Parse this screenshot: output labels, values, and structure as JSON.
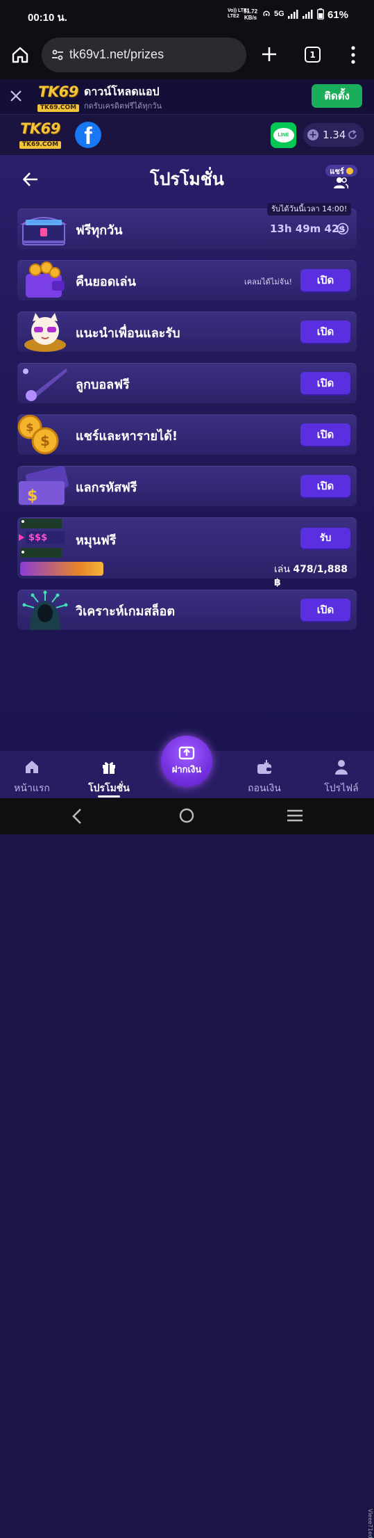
{
  "status_bar": {
    "time": "00:10 น.",
    "network_line1": "Vo)) LTE1",
    "network_line2": "LTE2",
    "speed_value": "51.72",
    "speed_unit": "KB/s",
    "network_type": "5G",
    "battery": "61%"
  },
  "browser": {
    "url": "tk69v1.net/prizes",
    "tab_count": "1"
  },
  "app_banner": {
    "logo_big": "TK69",
    "logo_small": "TK69.COM",
    "title": "ดาวน์โหลดแอป",
    "subtitle": "กดรับเครดิตฟรีได้ทุกวัน",
    "install_label": "ติดตั้ง"
  },
  "site_header": {
    "logo_big": "TK69",
    "logo_small": "TK69.COM",
    "facebook_glyph": "f",
    "line_label": "LINE",
    "balance": "1.34"
  },
  "page": {
    "title": "โปรโมชั่น",
    "share_label": "แชร์"
  },
  "promos": [
    {
      "label": "ฟรีทุกวัน",
      "tag": "รับได้วันนี้เวลา 14:00!",
      "timer": "13h 49m 42s"
    },
    {
      "label": "คืนยอดเล่น",
      "note": "เคลมได้ไม่จัน!",
      "button": "เปิด"
    },
    {
      "label": "แนะนำเพื่อนและรับ",
      "button": "เปิด"
    },
    {
      "label": "ลูกบอลฟรี",
      "button": "เปิด"
    },
    {
      "label": "แชร์และหารายได้!",
      "button": "เปิด"
    },
    {
      "label": "แลกรหัสฟรี",
      "button": "เปิด"
    },
    {
      "label": "หมุนฟรี",
      "button": "รับ",
      "play_label": "เล่น",
      "play_progress": "478/1,888 ฿",
      "progress_fraction": 0.253,
      "slot_text": "$$$"
    },
    {
      "label": "วิเคราะห์เกมสล็อต",
      "button": "เปิด"
    }
  ],
  "bottom_nav": {
    "home": "หน้าแรก",
    "promotions": "โปรโมชั่น",
    "deposit": "ฝากเงิน",
    "withdraw": "ถอนเงิน",
    "profile": "โปรไฟล์",
    "side_badge": "Vieee71ed"
  },
  "colors": {
    "accent_button": "#5a2fe0",
    "install_green": "#1aae5b",
    "brand_gold": "#f3c43a",
    "line_green": "#06c755",
    "facebook_blue": "#1877f2"
  }
}
